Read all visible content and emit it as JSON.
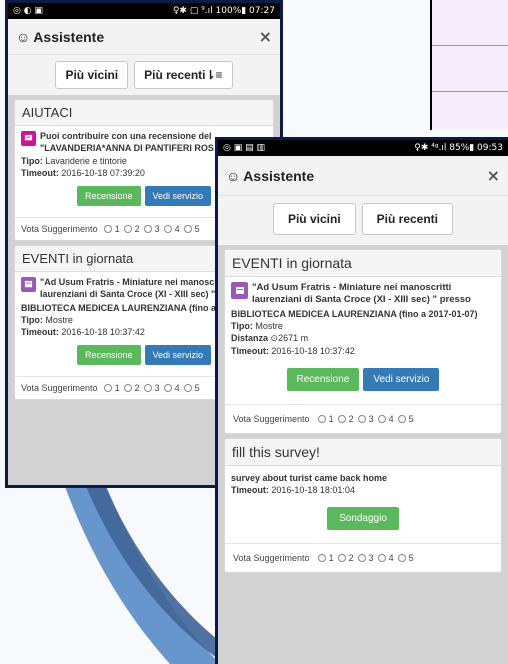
{
  "phone1": {
    "status": {
      "left_icons": "◎ ◐ ▣",
      "right": "♀✱ ▢ ⁹.ıl 100%▮ 07:27"
    },
    "appbar": {
      "title": "Assistente",
      "close": "×"
    },
    "tabs": [
      "Più vicini",
      "Più recenti⇂≡"
    ],
    "panel_aiutaci": {
      "heading": "AIUTACI",
      "text": "Puoi contribuire con una recensione del \"LAVANDERIA*ANNA DI PANTIFERI ROS",
      "tipo_label": "Tipo:",
      "tipo_value": "Lavanderie e tintorie",
      "timeout_label": "Timeout:",
      "timeout_value": "2016-10-18 07:39:20",
      "btn_recensione": "Recensione",
      "btn_vedi": "Vedi servizio",
      "vota_label": "Vota Suggerimento",
      "ratings": [
        "1",
        "2",
        "3",
        "4",
        "5"
      ]
    },
    "panel_eventi": {
      "heading": "EVENTI in giornata",
      "text": "\"Ad Usum Fratris - Miniature nei manoscr laurenziani di Santa Croce (XI - XIII sec) \"",
      "text2": "BIBLIOTECA MEDICEA LAURENZIANA (fino a 20",
      "tipo_label": "Tipo:",
      "tipo_value": "Mostre",
      "timeout_label": "Timeout:",
      "timeout_value": "2016-10-18 10:37:42",
      "btn_recensione": "Recensione",
      "btn_vedi": "Vedi servizio",
      "vota_label": "Vota Suggerimento",
      "ratings": [
        "1",
        "2",
        "3",
        "4",
        "5"
      ]
    }
  },
  "phone2": {
    "status": {
      "left_icons": "◎ ▣ ▤ ▥",
      "right": "♀✱ ⁴ᵍ.ıl 85%▮ 09:53"
    },
    "appbar": {
      "title": "Assistente",
      "close": "×"
    },
    "tabs": [
      "Più vicini",
      "Più recenti"
    ],
    "panel_eventi": {
      "heading": "EVENTI in giornata",
      "text": "\"Ad Usum Fratris - Miniature nei manoscritti laurenziani di Santa Croce (XI - XIII sec) \" presso",
      "text2": "BIBLIOTECA MEDICEA LAURENZIANA (fino a 2017-01-07)",
      "tipo_label": "Tipo:",
      "tipo_value": "Mostre",
      "distanza_label": "Distanza",
      "distanza_value": "2671 m",
      "timeout_label": "Timeout:",
      "timeout_value": "2016-10-18 10:37:42",
      "btn_recensione": "Recensione",
      "btn_vedi": "Vedi servizio",
      "vota_label": "Vota Suggerimento",
      "ratings": [
        "1",
        "2",
        "3",
        "4",
        "5"
      ]
    },
    "panel_survey": {
      "heading": "fill this survey!",
      "text": "survey about turist came back home",
      "timeout_label": "Timeout:",
      "timeout_value": "2016-10-18 18:01:04",
      "btn_sondaggio": "Sondaggio",
      "vota_label": "Vota Suggerimento",
      "ratings": [
        "1",
        "2",
        "3",
        "4",
        "5"
      ]
    }
  },
  "colors": {
    "accent_blue": "#337ab7",
    "accent_green": "#5cb85c",
    "pin_magenta": "#d0119a",
    "pin_purple": "#9b59b6",
    "frame": "#0b1b44"
  }
}
